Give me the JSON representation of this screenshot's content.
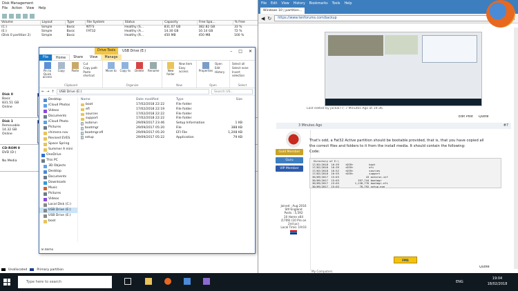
{
  "dm": {
    "title": "Disk Management",
    "menus": [
      "File",
      "Action",
      "View",
      "Help"
    ],
    "columns": [
      "Volume",
      "Layout",
      "Type",
      "File System",
      "Status",
      "Capacity",
      "Free Spa...",
      "% Free"
    ],
    "volumes": [
      [
        "(C:)",
        "Simple",
        "Basic",
        "NTFS",
        "Healthy (S...",
        "831.07 GB",
        "382.82 GB",
        "33 %"
      ],
      [
        "(E:)",
        "Simple",
        "Basic",
        "FAT32",
        "Healthy (A...",
        "14.30 GB",
        "10.14 GB",
        "72 %"
      ],
      [
        "(Disk 0 partition 2)",
        "Simple",
        "Basic",
        "",
        "Healthy (R...",
        "450 MB",
        "450 MB",
        "100 %"
      ]
    ],
    "disks": [
      {
        "name": "Disk 0",
        "l2": "Basic",
        "l3": "831.51 GB",
        "l4": "Online",
        "p1": "(C:)",
        "p2": "831.0",
        "p3": "Heal"
      },
      {
        "name": "Disk 1",
        "l2": "Removable",
        "l3": "14.32 GB",
        "l4": "Online",
        "p1": "(E:)",
        "p2": "14.32",
        "p3": "Heal"
      },
      {
        "name": "CD-ROM 0",
        "l2": "DVD (D:)",
        "l3": "",
        "l4": "No Media",
        "p1": "",
        "p2": "",
        "p3": ""
      }
    ],
    "legend_unalloc": "Unallocated",
    "legend_primary": "Primary partition"
  },
  "ex": {
    "title": "USB Drive (E:)",
    "context_tab": "Drive Tools",
    "tabs": [
      "File",
      "Home",
      "Share",
      "View",
      "Manage"
    ],
    "ribbon": {
      "clipboard": [
        "Pin to Quick access",
        "Copy",
        "Paste",
        "Cut",
        "Copy path",
        "Paste shortcut"
      ],
      "clipboard_label": "Clipboard",
      "organize": [
        "Move to",
        "Copy to",
        "Delete",
        "Rename"
      ],
      "organize_label": "Organize",
      "new": [
        "New folder",
        "New item",
        "Easy access"
      ],
      "new_label": "New",
      "open": [
        "Properties",
        "Open",
        "Edit",
        "History"
      ],
      "open_label": "Open",
      "select": [
        "Select all",
        "Select none",
        "Invert selection"
      ],
      "select_label": "Select"
    },
    "path": "USB Drive (E:)",
    "search": "Search US...",
    "nav": [
      "Desktop",
      "iCloud Photos",
      "Videos",
      "Documents",
      "iCloud Photo",
      "Pictures",
      "chimera nov",
      "Revised EVES",
      "Space Spring",
      "Summer A mini",
      "OneDrive",
      "This PC",
      "3D Objects",
      "Desktop",
      "Documents",
      "Downloads",
      "Music",
      "Pictures",
      "Videos",
      "Local Disk (C:)",
      "USB Drive (E:)",
      "USB Drive (E:)",
      "boot"
    ],
    "headers": [
      "Name",
      "Date modified",
      "Type",
      "Size"
    ],
    "files": [
      [
        "boot",
        "17/02/2018 22:22",
        "File folder",
        "",
        "folder"
      ],
      [
        "efi",
        "17/02/2018 22:19",
        "File folder",
        "",
        "folder"
      ],
      [
        "sources",
        "17/02/2018 22:22",
        "File folder",
        "",
        "folder"
      ],
      [
        "support",
        "17/02/2018 22:22",
        "File folder",
        "",
        "folder"
      ],
      [
        "autorun",
        "29/09/2017 23:46",
        "Setup Information",
        "1 KB",
        "file"
      ],
      [
        "bootmgr",
        "29/09/2017 05:20",
        "File",
        "388 KB",
        "file"
      ],
      [
        "bootmgr.efi",
        "29/09/2017 05:20",
        "EFI File",
        "1,208 KB",
        "file"
      ],
      [
        "setup",
        "29/09/2017 05:22",
        "Application",
        "79 KB",
        "file"
      ]
    ],
    "status": "8 items"
  },
  "ff": {
    "menus": [
      "File",
      "Edit",
      "View",
      "History",
      "Bookmarks",
      "Tools",
      "Help"
    ],
    "tab": "Windows 10 | partition...",
    "url": "https://www.tenforums.com/backup",
    "last_edited": "Last edited by jackal77; 7 Minutes Ago at 19:36.",
    "edit_post": "Edit Post",
    "quote": "Quote",
    "ago": "3 Minutes Ago",
    "post_no": "#7",
    "user": "Bree",
    "rank": "VIP Member",
    "badges": [
      "Gold Member",
      "Guru",
      "VIP Member"
    ],
    "joined": "Joined : Aug 2016",
    "loc": "Sth'England",
    "posts": "Posts : 5,592",
    "os": "10 Home x64",
    "os2": "(1709) (10 Pro on",
    "os3": "2nd pc)",
    "localtime": "Local Time: 19:03",
    "line1": "That's odd, a Fat32 Active partition should be bootable provided, that is, that you have copied all",
    "line2": "the correct files and folders to it from the install media. It should contain the following:",
    "code_label": "Code:",
    "code": " Directory of E:\\\n17/02/2018  16:39    <DIR>          boot\n17/02/2018  16:39    <DIR>          efi\n17/02/2018  16:52    <DIR>          sources\n17/02/2018  16:55    <DIR>          support\n30/09/2017  15:03                 43 autorun.inf\n30/09/2017  15:03            397,744 bootmgr\n30/09/2017  15:03          1,238,776 bootmgr.efi\n30/09/2017  15:03             78,792 setup.exe",
    "my_computers": "My Computers",
    "foot_quote": "Quote"
  },
  "taskbar": {
    "search": "Type here to search",
    "lang": "ENG",
    "time": "19:04",
    "date": "18/02/2018"
  }
}
